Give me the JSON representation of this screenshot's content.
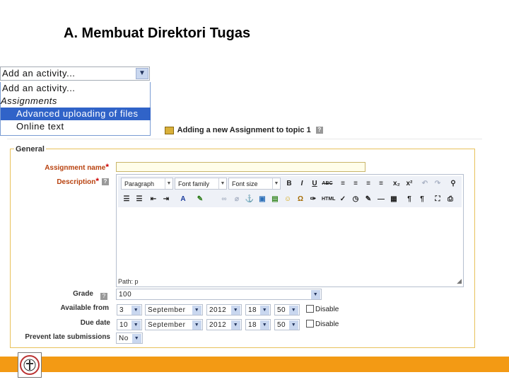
{
  "slide": {
    "title": "A. Membuat Direktori Tugas"
  },
  "activity_menu": {
    "selected": "Add an activity...",
    "items": [
      {
        "label": "Add an activity...",
        "kind": "option"
      },
      {
        "label": "Assignments",
        "kind": "group"
      },
      {
        "label": "Advanced uploading of files",
        "kind": "option",
        "highlighted": true
      },
      {
        "label": "Online text",
        "kind": "option"
      }
    ]
  },
  "form": {
    "header": "Adding a new Assignment to topic 1",
    "legend": "General",
    "name_label": "Assignment name",
    "description_label": "Description",
    "editor": {
      "format": "Paragraph",
      "font_family": "Font family",
      "font_size": "Font size",
      "path": "Path: p",
      "buttons_row1": [
        "B",
        "I",
        "U",
        "ABC"
      ],
      "html_label": "HTML"
    },
    "grade": {
      "label": "Grade",
      "value": "100"
    },
    "available_from": {
      "label": "Available from",
      "day": "3",
      "month": "September",
      "year": "2012",
      "hour": "18",
      "minute": "50",
      "disable": "Disable"
    },
    "due_date": {
      "label": "Due date",
      "day": "10",
      "month": "September",
      "year": "2012",
      "hour": "18",
      "minute": "50",
      "disable": "Disable"
    },
    "prevent_late": {
      "label": "Prevent late submissions",
      "value": "No"
    }
  },
  "colors": {
    "accent_bar": "#f39a14",
    "fieldset_border": "#e8c25b",
    "menu_highlight": "#3063c8"
  }
}
